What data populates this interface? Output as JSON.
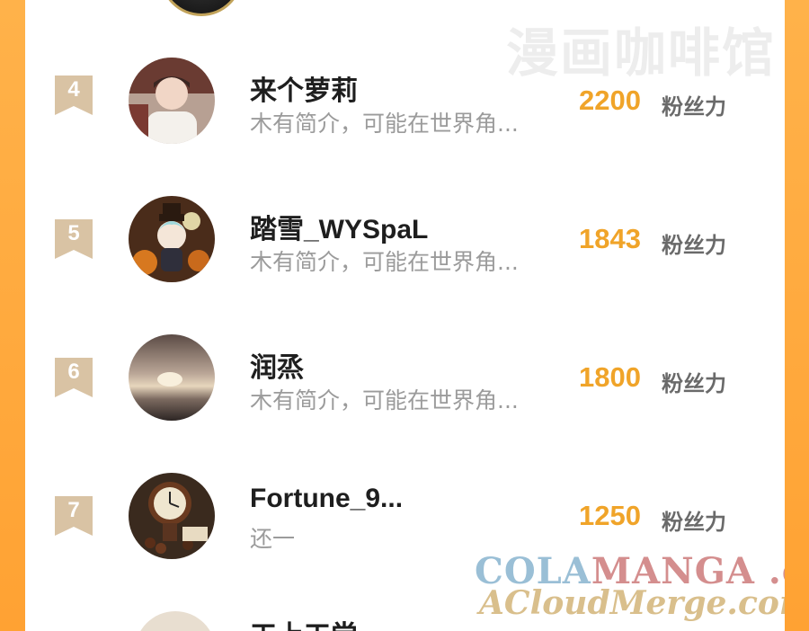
{
  "watermarks": {
    "top": "漫画咖啡馆",
    "colamanga_a": "COLA",
    "colamanga_b": "MANGA",
    "colamanga_c": " .com",
    "acloudmerge": "ACloudMerge.com"
  },
  "rows": [
    {
      "rank": "4",
      "name": "来个萝莉",
      "bio": "木有简介，可能在世界角...",
      "score": "2200",
      "unit": "粉丝力"
    },
    {
      "rank": "5",
      "name": "踏雪_WYSpaL",
      "bio": "木有简介，可能在世界角...",
      "score": "1843",
      "unit": "粉丝力"
    },
    {
      "rank": "6",
      "name": "润烝",
      "bio": "木有简介，可能在世界角...",
      "score": "1800",
      "unit": "粉丝力"
    },
    {
      "rank": "7",
      "name": "Fortune_9...",
      "bio": "还一",
      "score": "1250",
      "unit": "粉丝力"
    }
  ],
  "partial_next": {
    "name": "工上工尝"
  },
  "colors": {
    "accent": "#f0a429",
    "frame": "#ffa233",
    "rank_badge": "#d7c2a6"
  }
}
